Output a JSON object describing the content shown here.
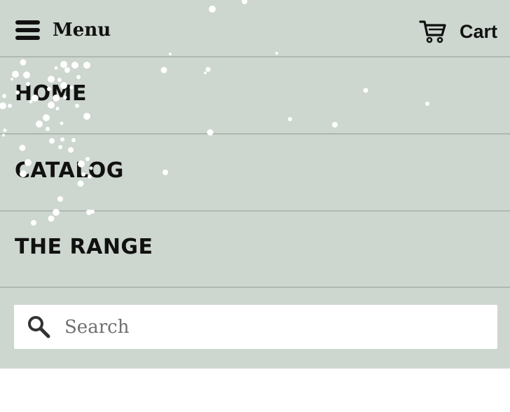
{
  "header": {
    "menu_label": "Menu",
    "menu_icon": "hamburger-icon",
    "cart_label": "Cart",
    "cart_icon": "cart-icon"
  },
  "nav": {
    "items": [
      {
        "label": "HOME"
      },
      {
        "label": "CATALOG"
      },
      {
        "label": "THE RANGE"
      }
    ]
  },
  "search": {
    "placeholder": "Search",
    "icon": "search-icon"
  },
  "colors": {
    "panel_bg": "#cdd6cf",
    "divider": "#b0b8b2",
    "text": "#111111",
    "page_bg": "#ffffff"
  }
}
